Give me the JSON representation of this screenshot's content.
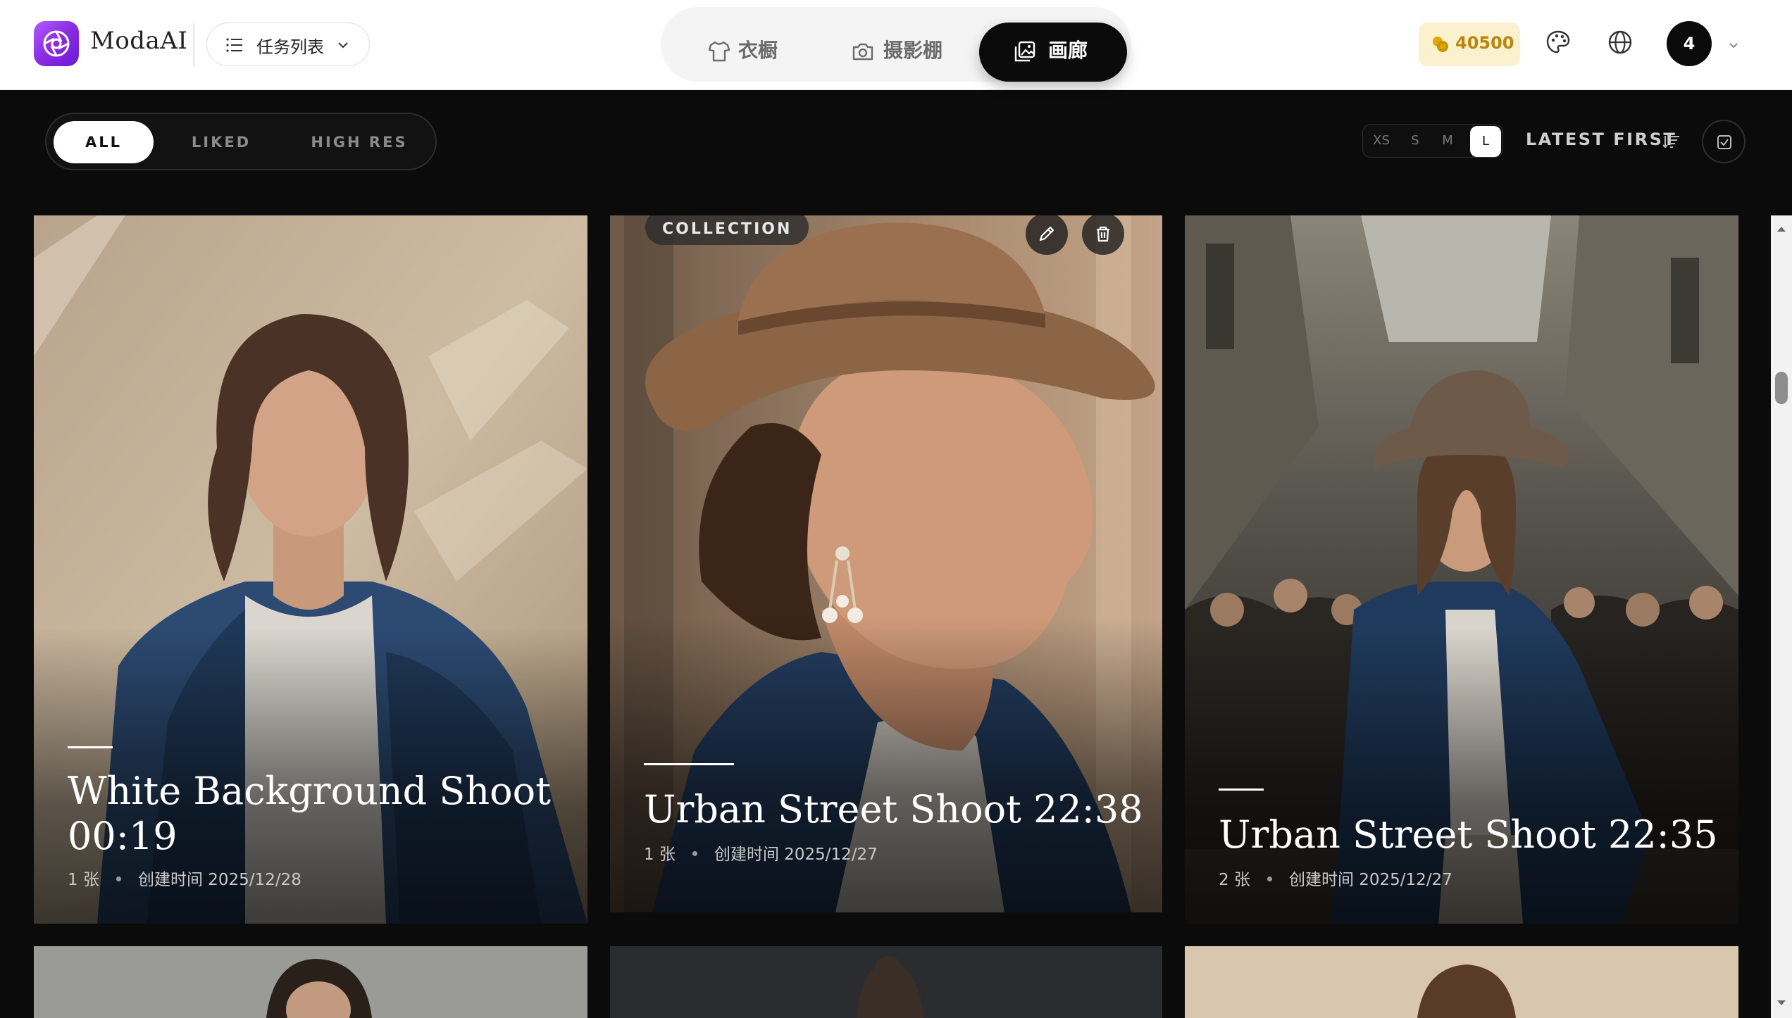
{
  "app": {
    "brand": "ModaAI"
  },
  "header": {
    "task_list_label": "任务列表",
    "nav_tabs": [
      {
        "label": "衣橱",
        "icon": "shirt-icon",
        "active": false
      },
      {
        "label": "摄影棚",
        "icon": "camera-icon",
        "active": false
      },
      {
        "label": "画廊",
        "icon": "gallery-icon",
        "active": true
      }
    ],
    "credits": "40500",
    "avatar_initial": "4"
  },
  "filters": {
    "tabs": [
      {
        "label": "ALL",
        "active": true
      },
      {
        "label": "LIKED",
        "active": false
      },
      {
        "label": "HIGH RES",
        "active": false
      }
    ],
    "sizes": [
      {
        "label": "XS",
        "active": false
      },
      {
        "label": "S",
        "active": false
      },
      {
        "label": "M",
        "active": false
      },
      {
        "label": "L",
        "active": true
      }
    ],
    "sort_label": "LATEST FIRST"
  },
  "gallery": {
    "cards": [
      {
        "title": "White Background Shoot 00:19",
        "count": "1 张",
        "created": "创建时间 2025/12/28"
      },
      {
        "badge": "COLLECTION",
        "title": "Urban Street Shoot 22:38",
        "count": "1 张",
        "created": "创建时间 2025/12/27"
      },
      {
        "title": "Urban Street Shoot 22:35",
        "count": "2 张",
        "created": "创建时间 2025/12/27"
      }
    ]
  },
  "colors": {
    "accent": "#8a2be2",
    "dark": "#0b0b0b",
    "credits_text": "#b8860b"
  }
}
